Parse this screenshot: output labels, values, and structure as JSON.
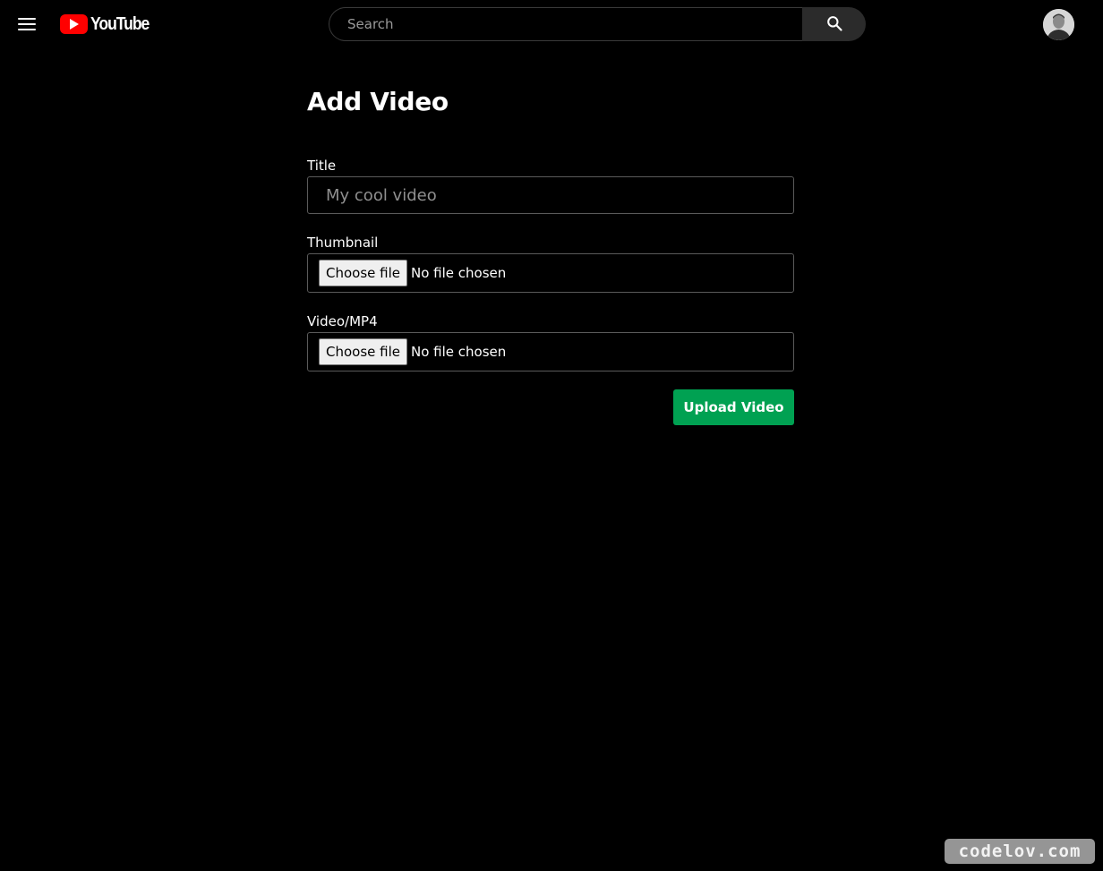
{
  "header": {
    "logo_text": "YouTube",
    "search_placeholder": "Search",
    "icons": {
      "menu": "hamburger-menu-icon",
      "search": "search-icon",
      "avatar": "user-avatar"
    }
  },
  "form": {
    "title": "Add Video",
    "title_field": {
      "label": "Title",
      "placeholder": "My cool video",
      "value": ""
    },
    "thumbnail_field": {
      "label": "Thumbnail",
      "button_label": "Choose file",
      "status": "No file chosen"
    },
    "video_field": {
      "label": "Video/MP4",
      "button_label": "Choose file",
      "status": "No file chosen"
    },
    "submit_label": "Upload Video"
  },
  "watermark": "codelov.com",
  "colors": {
    "background": "#000000",
    "brand_red": "#ff0000",
    "submit_green": "#00a152",
    "border": "#5a5a5a"
  }
}
